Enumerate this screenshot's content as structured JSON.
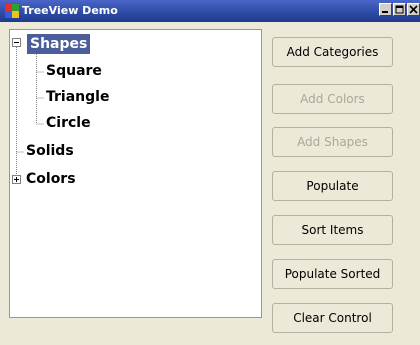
{
  "window": {
    "title": "TreeView Demo",
    "controls": [
      "minimize-icon",
      "maximize-icon",
      "close-icon"
    ]
  },
  "tree": {
    "nodes": [
      {
        "label": "Shapes",
        "level": 0,
        "expanded": true,
        "selected": true
      },
      {
        "label": "Square",
        "level": 1
      },
      {
        "label": "Triangle",
        "level": 1
      },
      {
        "label": "Circle",
        "level": 1
      },
      {
        "label": "Solids",
        "level": 0
      },
      {
        "label": "Colors",
        "level": 0,
        "expanded": false
      }
    ]
  },
  "buttons": {
    "add_categories": "Add Categories",
    "add_colors": "Add Colors",
    "add_shapes": "Add Shapes",
    "populate": "Populate",
    "sort_items": "Sort Items",
    "populate_sorted": "Populate Sorted",
    "clear_control": "Clear Control"
  },
  "colors": {
    "titlebar": "#2f4ca6",
    "selection": "#4b5e99",
    "disabled_text": "#aca899"
  }
}
